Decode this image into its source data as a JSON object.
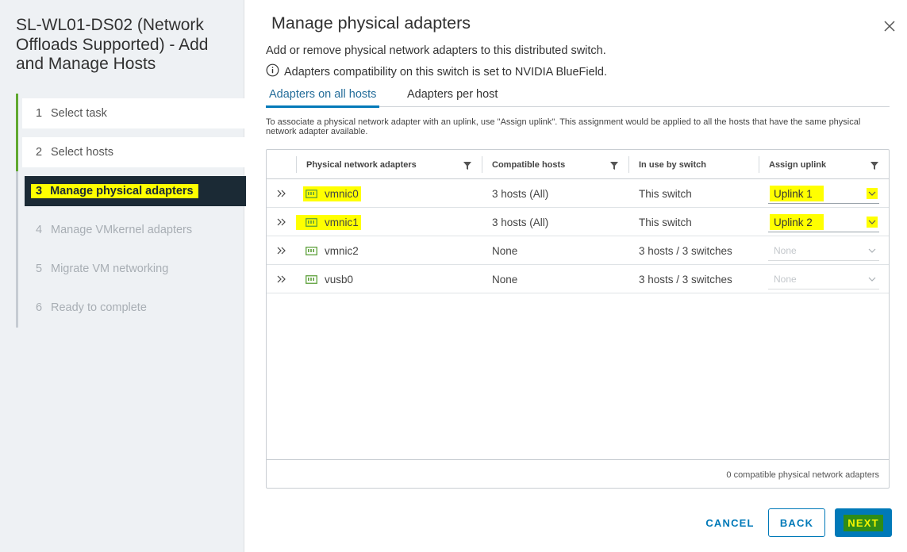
{
  "wizard": {
    "title": "SL-WL01-DS02 (Network Offloads Supported) - Add and Manage Hosts"
  },
  "steps": [
    {
      "num": "1",
      "label": "Select task",
      "state": "done"
    },
    {
      "num": "2",
      "label": "Select hosts",
      "state": "done"
    },
    {
      "num": "3",
      "label": "Manage physical adapters",
      "state": "active"
    },
    {
      "num": "4",
      "label": "Manage VMkernel adapters",
      "state": "todo"
    },
    {
      "num": "5",
      "label": "Migrate VM networking",
      "state": "todo"
    },
    {
      "num": "6",
      "label": "Ready to complete",
      "state": "todo"
    }
  ],
  "page": {
    "title": "Manage physical adapters",
    "subtitle": "Add or remove physical network adapters to this distributed switch.",
    "compat_note": "Adapters compatibility on this switch is set to NVIDIA BlueField.",
    "help_text": "To associate a physical network adapter with an uplink, use \"Assign uplink\". This assignment would be applied to all the hosts that have the same physical network adapter available."
  },
  "tabs": [
    {
      "label": "Adapters on all hosts",
      "selected": true
    },
    {
      "label": "Adapters per host",
      "selected": false
    }
  ],
  "grid": {
    "columns": [
      "Physical network adapters",
      "Compatible hosts",
      "In use by switch",
      "Assign uplink"
    ],
    "rows": [
      {
        "adapter": "vmnic0",
        "hosts": "3 hosts (All)",
        "in_use": "This switch",
        "uplink": "Uplink 1",
        "enabled": true
      },
      {
        "adapter": "vmnic1",
        "hosts": "3 hosts (All)",
        "in_use": "This switch",
        "uplink": "Uplink 2",
        "enabled": true
      },
      {
        "adapter": "vmnic2",
        "hosts": "None",
        "in_use": "3 hosts / 3 switches",
        "uplink": "None",
        "enabled": false
      },
      {
        "adapter": "vusb0",
        "hosts": "None",
        "in_use": "3 hosts / 3 switches",
        "uplink": "None",
        "enabled": false
      }
    ],
    "footer": "0 compatible physical network adapters"
  },
  "buttons": {
    "cancel": "CANCEL",
    "back": "BACK",
    "next": "NEXT"
  },
  "colors": {
    "accent": "#0079b8",
    "done_rail": "#60a82f",
    "active_step_bg": "#1b2a35",
    "highlight": "#ffff00",
    "nic_icon": "#5da03a"
  },
  "icons": {
    "close": "close-icon",
    "info": "info-icon",
    "filter": "filter-icon",
    "expand": "double-chevron-right-icon",
    "nic": "network-adapter-icon",
    "dropdown": "chevron-down-icon"
  }
}
